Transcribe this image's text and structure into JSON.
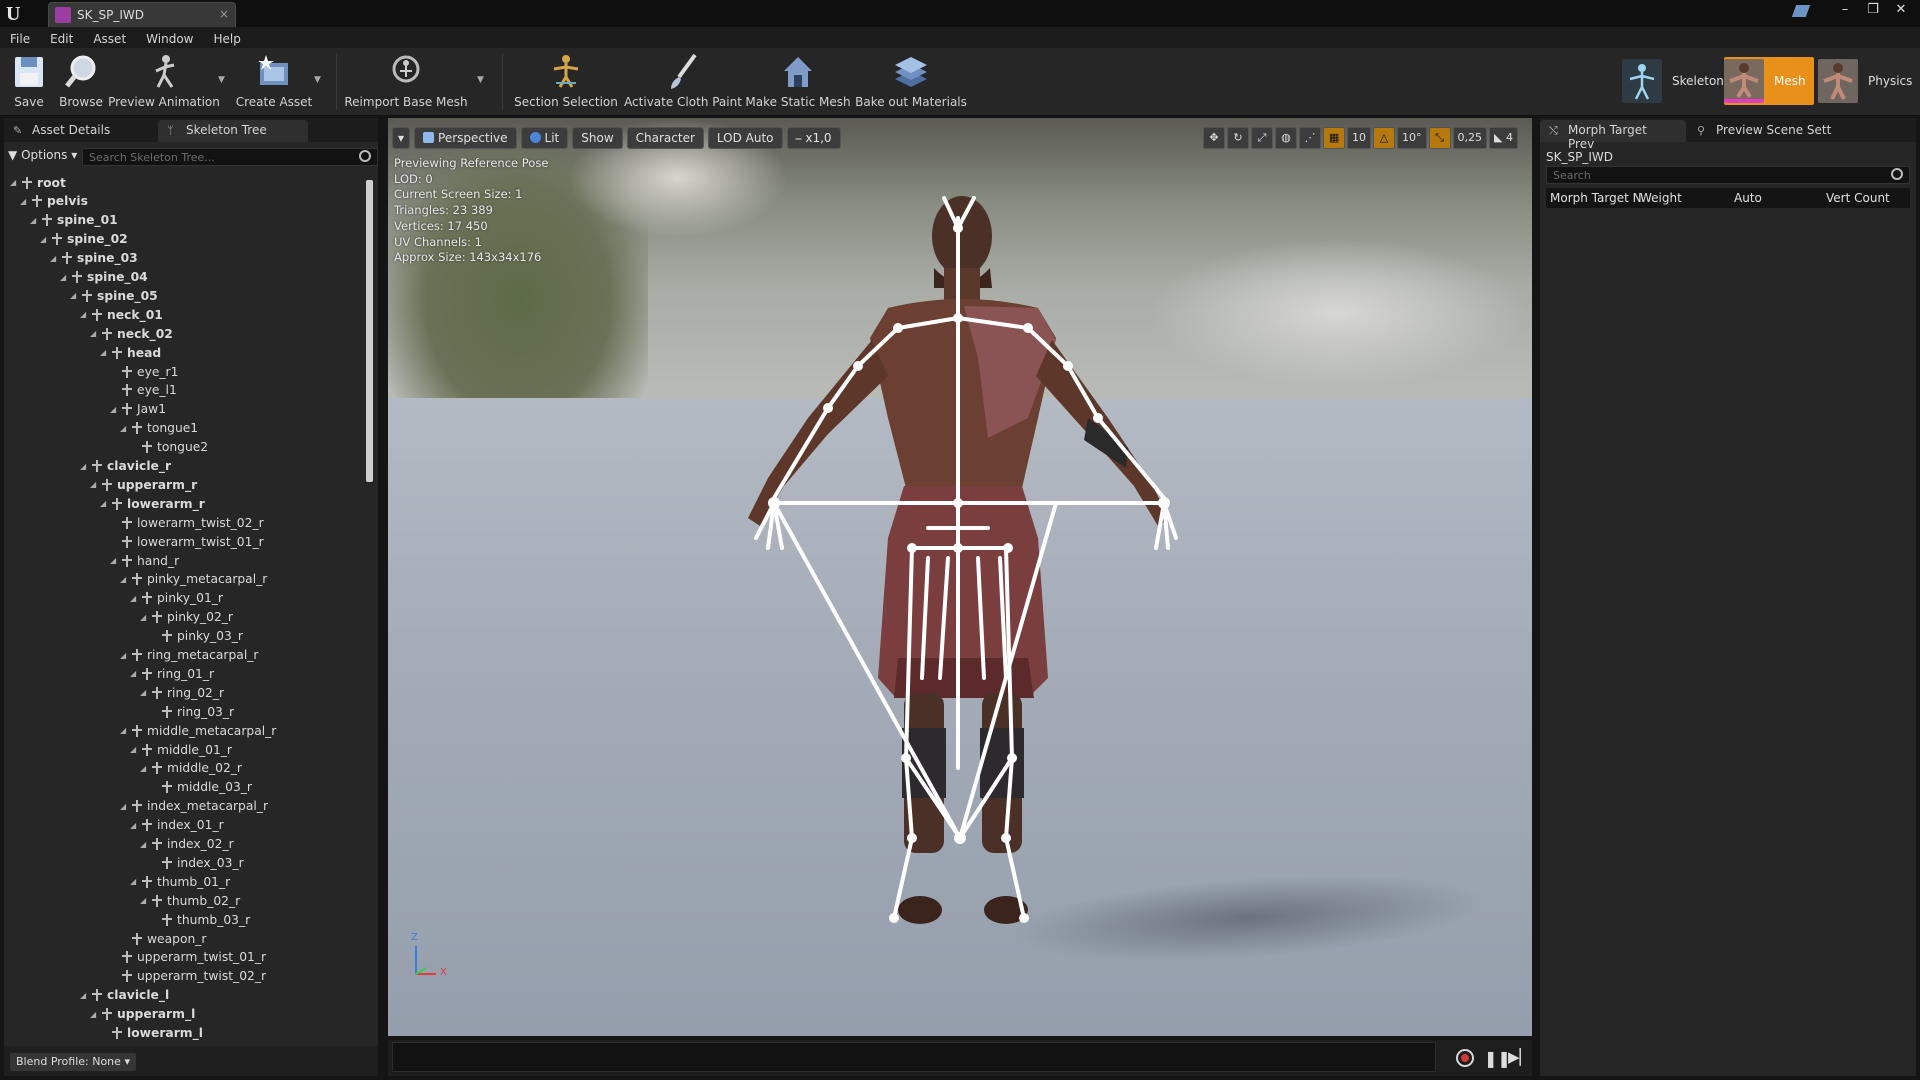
{
  "window": {
    "tab_title": "SK_SP_IWD",
    "close_glyph": "×",
    "controls": [
      "–",
      "❐",
      "✕"
    ]
  },
  "menu": [
    "File",
    "Edit",
    "Asset",
    "Window",
    "Help"
  ],
  "toolbar": {
    "save": "Save",
    "browse": "Browse",
    "preview_animation": "Preview Animation",
    "create_asset": "Create Asset",
    "reimport_base_mesh": "Reimport Base Mesh",
    "section_selection": "Section Selection",
    "activate_cloth_paint": "Activate Cloth Paint",
    "make_static_mesh": "Make Static Mesh",
    "bake_out_materials": "Bake out Materials"
  },
  "modes": {
    "skeleton": "Skeleton",
    "mesh": "Mesh",
    "physics": "Physics"
  },
  "left_panel": {
    "tabs": [
      "Asset Details",
      "Skeleton Tree"
    ],
    "options_label": "Options",
    "search_placeholder": "Search Skeleton Tree...",
    "tree": [
      {
        "name": "root",
        "depth": 0
      },
      {
        "name": "pelvis",
        "depth": 1
      },
      {
        "name": "spine_01",
        "depth": 2
      },
      {
        "name": "spine_02",
        "depth": 3
      },
      {
        "name": "spine_03",
        "depth": 4
      },
      {
        "name": "spine_04",
        "depth": 5
      },
      {
        "name": "spine_05",
        "depth": 6
      },
      {
        "name": "neck_01",
        "depth": 7
      },
      {
        "name": "neck_02",
        "depth": 8
      },
      {
        "name": "head",
        "depth": 9
      },
      {
        "name": "eye_r1",
        "depth": 10
      },
      {
        "name": "eye_l1",
        "depth": 10
      },
      {
        "name": "Jaw1",
        "depth": 10
      },
      {
        "name": "tongue1",
        "depth": 11
      },
      {
        "name": "tongue2",
        "depth": 12
      },
      {
        "name": "clavicle_r",
        "depth": 7
      },
      {
        "name": "upperarm_r",
        "depth": 8
      },
      {
        "name": "lowerarm_r",
        "depth": 9
      },
      {
        "name": "lowerarm_twist_02_r",
        "depth": 10
      },
      {
        "name": "lowerarm_twist_01_r",
        "depth": 10
      },
      {
        "name": "hand_r",
        "depth": 10
      },
      {
        "name": "pinky_metacarpal_r",
        "depth": 11
      },
      {
        "name": "pinky_01_r",
        "depth": 12
      },
      {
        "name": "pinky_02_r",
        "depth": 13
      },
      {
        "name": "pinky_03_r",
        "depth": 14
      },
      {
        "name": "ring_metacarpal_r",
        "depth": 11
      },
      {
        "name": "ring_01_r",
        "depth": 12
      },
      {
        "name": "ring_02_r",
        "depth": 13
      },
      {
        "name": "ring_03_r",
        "depth": 14
      },
      {
        "name": "middle_metacarpal_r",
        "depth": 11
      },
      {
        "name": "middle_01_r",
        "depth": 12
      },
      {
        "name": "middle_02_r",
        "depth": 13
      },
      {
        "name": "middle_03_r",
        "depth": 14
      },
      {
        "name": "index_metacarpal_r",
        "depth": 11
      },
      {
        "name": "index_01_r",
        "depth": 12
      },
      {
        "name": "index_02_r",
        "depth": 13
      },
      {
        "name": "index_03_r",
        "depth": 14
      },
      {
        "name": "thumb_01_r",
        "depth": 12
      },
      {
        "name": "thumb_02_r",
        "depth": 13
      },
      {
        "name": "thumb_03_r",
        "depth": 14
      },
      {
        "name": "weapon_r",
        "depth": 11
      },
      {
        "name": "upperarm_twist_01_r",
        "depth": 10
      },
      {
        "name": "upperarm_twist_02_r",
        "depth": 10
      },
      {
        "name": "clavicle_l",
        "depth": 7
      },
      {
        "name": "upperarm_l",
        "depth": 8
      },
      {
        "name": "lowerarm_l",
        "depth": 9
      }
    ],
    "blend_profile": "Blend Profile: None"
  },
  "viewport": {
    "buttons": [
      "Perspective",
      "Lit",
      "Show",
      "Character",
      "LOD Auto",
      "x1,0"
    ],
    "right_tools": {
      "grid_snap": "10",
      "rotation_snap": "10°",
      "scale_snap": "0,25",
      "camera_speed": "4"
    },
    "info": [
      "Previewing Reference Pose",
      "LOD: 0",
      "Current Screen Size: 1",
      "Triangles: 23 389",
      "Vertices: 17 450",
      "UV Channels: 1",
      "Approx Size: 143x34x176"
    ],
    "gizmo": {
      "z": "Z",
      "x": "X"
    }
  },
  "right_panel": {
    "tabs": [
      "Morph Target Prev",
      "Preview Scene Sett"
    ],
    "asset_name": "SK_SP_IWD",
    "search_placeholder": "Search",
    "columns": [
      "Morph Target N",
      "Weight",
      "Auto",
      "Vert Count"
    ]
  },
  "colors": {
    "accent_orange": "#e8901a",
    "panel_bg": "#262626",
    "viewport_floor": "#a4acb8"
  }
}
